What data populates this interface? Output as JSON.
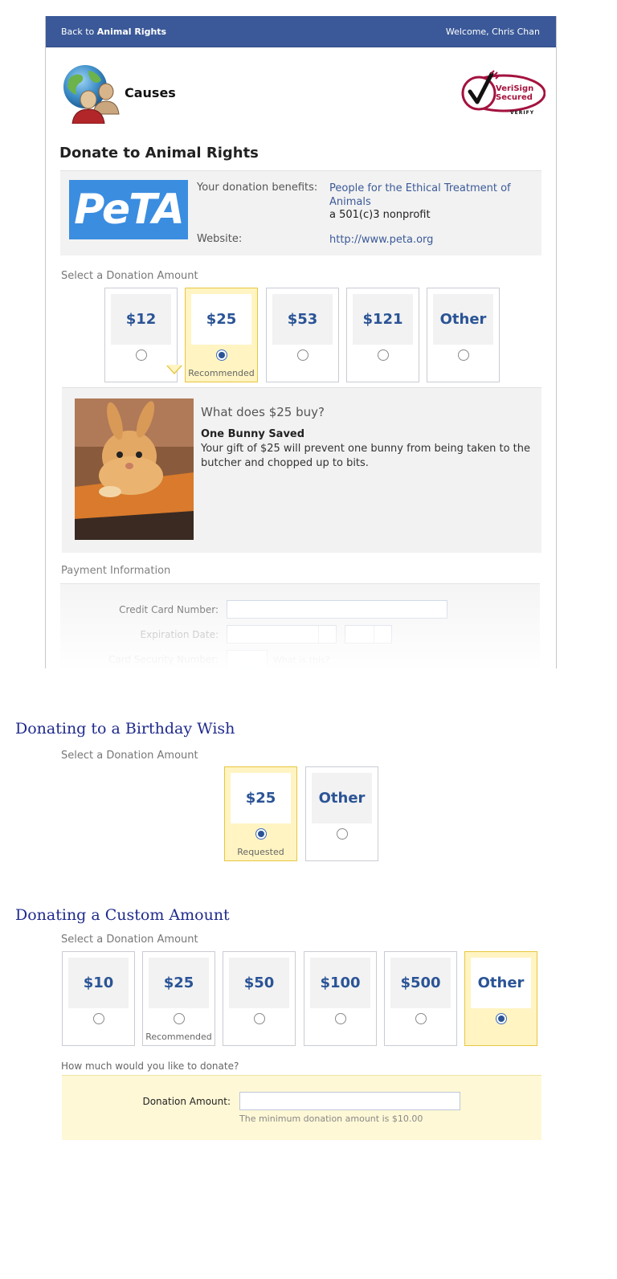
{
  "topbar": {
    "back_prefix": "Back to ",
    "back_target": "Animal Rights",
    "welcome": "Welcome, Chris Chan"
  },
  "header": {
    "app_name": "Causes",
    "security_badge_line1": "VeriSign",
    "security_badge_line2": "Secured",
    "security_badge_verify": "VERIFY"
  },
  "donate": {
    "title": "Donate to Animal Rights",
    "org_logo_text": "PeTA",
    "benefits_label": "Your donation benefits:",
    "org_name": "People for the Ethical Treatment of Animals",
    "org_type": "a 501(c)3 nonprofit",
    "website_label": "Website:",
    "website": "http://www.peta.org",
    "select_label": "Select a Donation Amount",
    "amounts": [
      {
        "label": "$12",
        "selected": false,
        "note": ""
      },
      {
        "label": "$25",
        "selected": true,
        "note": "Recommended"
      },
      {
        "label": "$53",
        "selected": false,
        "note": ""
      },
      {
        "label": "$121",
        "selected": false,
        "note": ""
      },
      {
        "label": "Other",
        "selected": false,
        "note": ""
      }
    ],
    "buy_question": "What does $25 buy?",
    "buy_title": "One Bunny Saved",
    "buy_text": "Your gift of $25 will prevent one bunny from being taken to the butcher and chopped up to bits."
  },
  "payment": {
    "header": "Payment Information",
    "card_number_label": "Credit Card Number:",
    "expiration_label": "Expiration Date:",
    "security_label": "Card Security Number:",
    "what_is_this": "What is this?"
  },
  "birthday": {
    "title": "Donating to a Birthday Wish",
    "select_label": "Select a Donation Amount",
    "amounts": [
      {
        "label": "$25",
        "selected": true,
        "note": "Requested"
      },
      {
        "label": "Other",
        "selected": false,
        "note": ""
      }
    ]
  },
  "custom": {
    "title": "Donating a Custom Amount",
    "select_label": "Select a Donation Amount",
    "amounts": [
      {
        "label": "$10",
        "selected": false,
        "note": ""
      },
      {
        "label": "$25",
        "selected": false,
        "note": "Recommended"
      },
      {
        "label": "$50",
        "selected": false,
        "note": ""
      },
      {
        "label": "$100",
        "selected": false,
        "note": ""
      },
      {
        "label": "$500",
        "selected": false,
        "note": ""
      },
      {
        "label": "Other",
        "selected": true,
        "note": ""
      }
    ],
    "question": "How much would you like to donate?",
    "amount_label": "Donation Amount:",
    "amount_value": "",
    "minimum_note": "The minimum donation amount is $10.00"
  },
  "colors": {
    "brand_bar": "#3b5998",
    "link": "#3b5998",
    "selected_bg": "#fff4c2",
    "selected_border": "#e8c640",
    "amount_text": "#2b5496",
    "section_title": "#1f2a8c"
  }
}
